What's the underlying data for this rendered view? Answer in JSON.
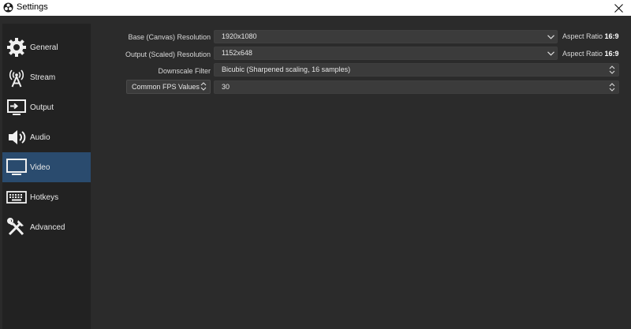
{
  "window": {
    "title": "Settings"
  },
  "sidebar": {
    "items": [
      {
        "label": "General",
        "icon": "gear-icon",
        "active": false
      },
      {
        "label": "Stream",
        "icon": "antenna-icon",
        "active": false
      },
      {
        "label": "Output",
        "icon": "output-monitor-icon",
        "active": false
      },
      {
        "label": "Audio",
        "icon": "speaker-icon",
        "active": false
      },
      {
        "label": "Video",
        "icon": "monitor-icon",
        "active": true
      },
      {
        "label": "Hotkeys",
        "icon": "keyboard-icon",
        "active": false
      },
      {
        "label": "Advanced",
        "icon": "tools-icon",
        "active": false
      }
    ]
  },
  "video": {
    "base_resolution": {
      "label": "Base (Canvas) Resolution",
      "value": "1920x1080",
      "aspect_label": "Aspect Ratio",
      "aspect_value": "16:9"
    },
    "output_resolution": {
      "label": "Output (Scaled) Resolution",
      "value": "1152x648",
      "aspect_label": "Aspect Ratio",
      "aspect_value": "16:9"
    },
    "downscale_filter": {
      "label": "Downscale Filter",
      "value": "Bicubic (Sharpened scaling, 16 samples)"
    },
    "fps": {
      "mode": "Common FPS Values",
      "value": "30"
    }
  },
  "colors": {
    "window_bg": "#2b2b2b",
    "sidebar_bg": "#222222",
    "active_item": "#2a4b6e",
    "field_bg": "#3b3b3b"
  }
}
